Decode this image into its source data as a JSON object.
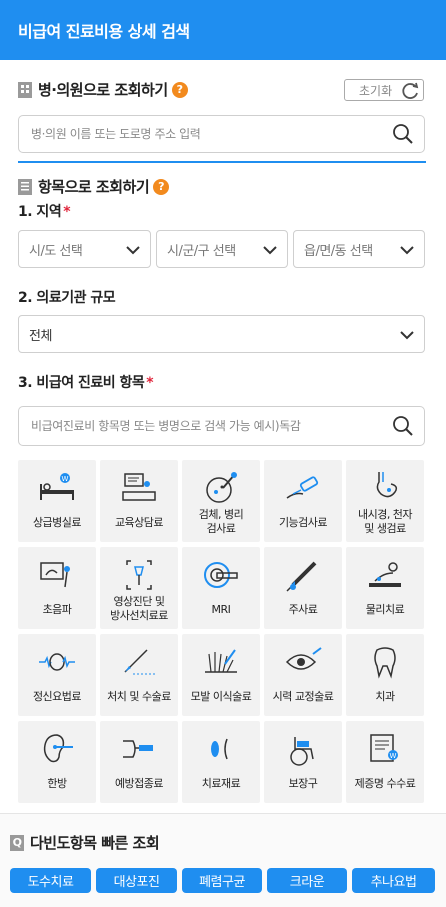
{
  "header": {
    "title": "비급여 진료비용 상세 검색"
  },
  "hospital_section": {
    "title": "병·의원으로 조회하기",
    "help": "?",
    "reset_label": "초기화",
    "search_placeholder": "병·의원 이름 또는 도로명 주소 입력"
  },
  "item_section": {
    "title": "항목으로 조회하기",
    "help": "?",
    "region": {
      "label": "1. 지역",
      "required": "*",
      "selects": [
        "시/도 선택",
        "시/군/구 선택",
        "읍/면/동 선택"
      ]
    },
    "scale": {
      "label": "2. 의료기관 규모",
      "value": "전체"
    },
    "items": {
      "label": "3. 비급여 진료비 항목",
      "required": "*",
      "search_placeholder": "비급여진료비 항목명 또는 병명으로 검색 가능 예시)독감",
      "tiles": [
        {
          "label": "상급병실료",
          "icon": "bed-icon"
        },
        {
          "label": "교육상담료",
          "icon": "consult-icon"
        },
        {
          "label": "검체, 병리\n검사료",
          "icon": "specimen-icon"
        },
        {
          "label": "기능검사료",
          "icon": "function-test-icon"
        },
        {
          "label": "내시경, 천자\n및 생검료",
          "icon": "endoscope-icon"
        },
        {
          "label": "초음파",
          "icon": "ultrasound-icon"
        },
        {
          "label": "영상진단 및\n방사선치료료",
          "icon": "xray-icon"
        },
        {
          "label": "MRI",
          "icon": "mri-icon"
        },
        {
          "label": "주사료",
          "icon": "syringe-icon"
        },
        {
          "label": "물리치료",
          "icon": "physio-icon"
        },
        {
          "label": "정신요법료",
          "icon": "brain-icon"
        },
        {
          "label": "처치 및 수술료",
          "icon": "scalpel-icon"
        },
        {
          "label": "모발 이식술료",
          "icon": "hair-icon"
        },
        {
          "label": "시력 교정술료",
          "icon": "eye-icon"
        },
        {
          "label": "치과",
          "icon": "tooth-icon"
        },
        {
          "label": "한방",
          "icon": "ear-acupuncture-icon"
        },
        {
          "label": "예방접종료",
          "icon": "vaccine-icon"
        },
        {
          "label": "치료재료",
          "icon": "material-icon"
        },
        {
          "label": "보장구",
          "icon": "wheelchair-icon"
        },
        {
          "label": "제증명 수수료",
          "icon": "certificate-icon"
        }
      ]
    }
  },
  "quick": {
    "badge": "Q",
    "title": "다빈도항목 빠른 조회",
    "chips": [
      "도수치료",
      "대상포진",
      "폐렴구균",
      "크라운",
      "추나요법"
    ]
  },
  "colors": {
    "primary": "#1f8ef0",
    "help": "#f28a1e",
    "required": "#e0243a",
    "tile_bg": "#f2f2f2"
  }
}
